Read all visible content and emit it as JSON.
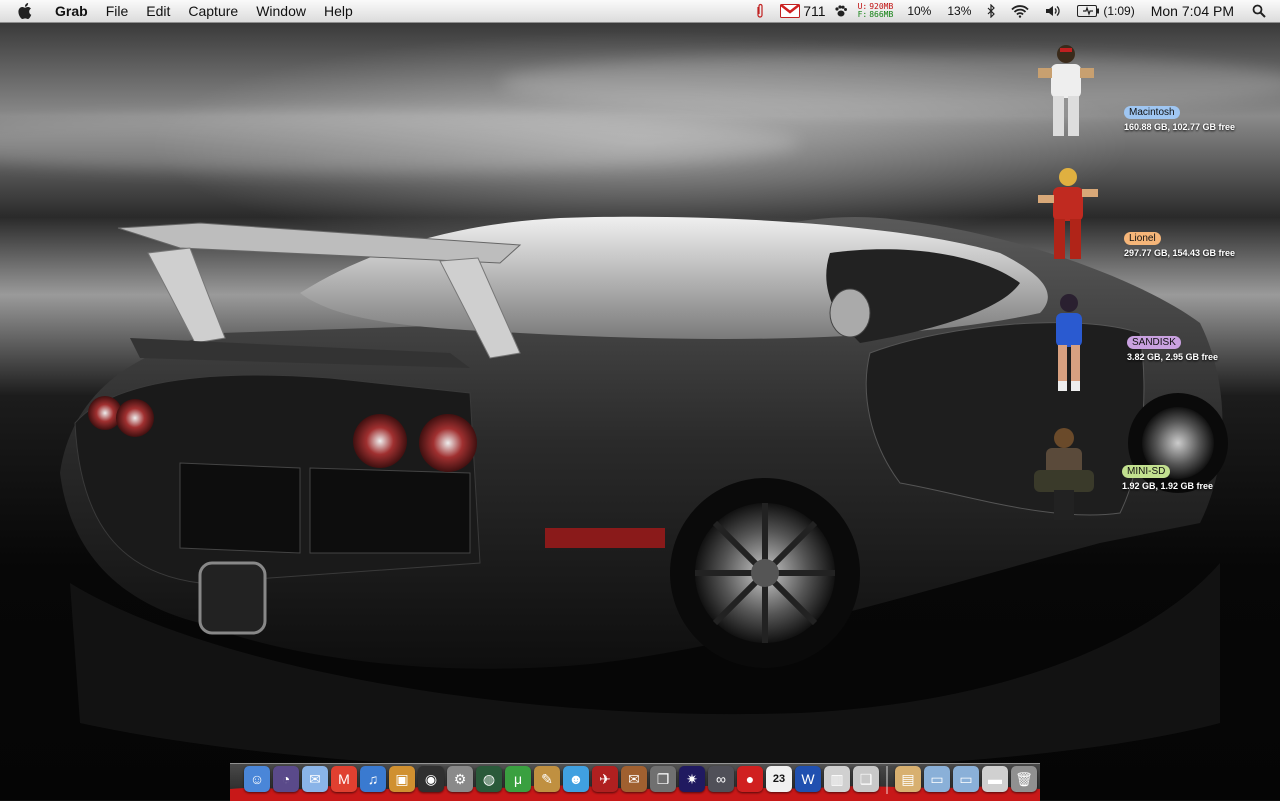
{
  "menubar": {
    "app_name": "Grab",
    "menus": [
      "File",
      "Edit",
      "Capture",
      "Window",
      "Help"
    ],
    "status": {
      "gmail_count": "711",
      "mem_used_label": "U:",
      "mem_free_label": "F:",
      "mem_used": "920MB",
      "mem_free": "866MB",
      "cpu1": "10%",
      "cpu2": "13%",
      "battery_time": "(1:09)",
      "clock": "Mon 7:04 PM"
    }
  },
  "drives": [
    {
      "name": "Macintosh",
      "info": "160.88 GB, 102.77 GB free",
      "color": "#9fc6f2"
    },
    {
      "name": "Lionel",
      "info": "297.77 GB, 154.43 GB free",
      "color": "#f6b679"
    },
    {
      "name": "SANDISK",
      "info": "3.82 GB, 2.95 GB free",
      "color": "#c9a1e0"
    },
    {
      "name": "MINI-SD",
      "info": "1.92 GB, 1.92 GB free",
      "color": "#c2e08f"
    }
  ],
  "dock": {
    "apps": [
      {
        "icon": "finder-icon",
        "color": "#4a86d8"
      },
      {
        "icon": "dashboard-icon",
        "color": "#5a4a8a"
      },
      {
        "icon": "mail-icon",
        "color": "#8ab4e8"
      },
      {
        "icon": "gmail-icon",
        "color": "#e04030"
      },
      {
        "icon": "itunes-icon",
        "color": "#3a7ad0"
      },
      {
        "icon": "iphoto-icon",
        "color": "#d09030"
      },
      {
        "icon": "camera-icon",
        "color": "#303030"
      },
      {
        "icon": "system-preferences-icon",
        "color": "#8a8a8a"
      },
      {
        "icon": "globe-icon",
        "color": "#2a5a3a"
      },
      {
        "icon": "utorrent-icon",
        "color": "#3aa040"
      },
      {
        "icon": "tool-icon",
        "color": "#c09040"
      },
      {
        "icon": "messenger-icon",
        "color": "#40a0e0"
      },
      {
        "icon": "bird-icon",
        "color": "#b02020"
      },
      {
        "icon": "stamp-icon",
        "color": "#a06030"
      },
      {
        "icon": "windows-icon",
        "color": "#707070"
      },
      {
        "icon": "spotlight-app-icon",
        "color": "#201a60"
      },
      {
        "icon": "link-icon",
        "color": "#505058"
      },
      {
        "icon": "red-ball-icon",
        "color": "#d02020"
      },
      {
        "icon": "calendar-icon",
        "color": "#f0f0f0"
      },
      {
        "icon": "word-icon",
        "color": "#2050b0"
      },
      {
        "icon": "chart-app-icon",
        "color": "#d0d0d0"
      },
      {
        "icon": "preview-icon",
        "color": "#c8c8c8"
      }
    ],
    "folders": [
      {
        "icon": "documents-folder-icon",
        "color": "#d8b070"
      },
      {
        "icon": "applications-folder-icon",
        "color": "#8ab0d8"
      },
      {
        "icon": "downloads-folder-icon",
        "color": "#8ab0d8"
      },
      {
        "icon": "drive-stack-icon",
        "color": "#d0d0d0"
      },
      {
        "icon": "trash-icon",
        "color": "#909090"
      }
    ],
    "calendar_date": "23"
  }
}
